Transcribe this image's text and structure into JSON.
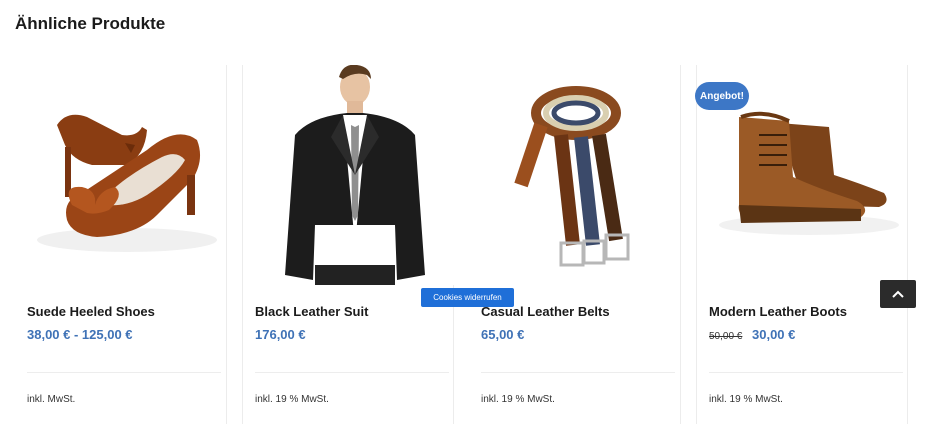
{
  "section": {
    "title": "Ähnliche Produkte"
  },
  "products": [
    {
      "name": "Suede Heeled Shoes",
      "price": "38,00 € - 125,00 €",
      "old_price": "",
      "tax": "inkl. MwSt.",
      "image_icon": "suede-heeled-shoes-image"
    },
    {
      "name": "Black Leather Suit",
      "price": "176,00 €",
      "old_price": "",
      "tax": "inkl. 19 % MwSt.",
      "image_icon": "black-leather-suit-image"
    },
    {
      "name": "Casual Leather Belts",
      "price": "65,00 €",
      "old_price": "",
      "tax": "inkl. 19 % MwSt.",
      "image_icon": "leather-belts-image"
    },
    {
      "name": "Modern Leather Boots",
      "price": "30,00 €",
      "old_price": "50,00 €",
      "tax": "inkl. 19 % MwSt.",
      "image_icon": "leather-boots-image"
    }
  ],
  "badge": {
    "label": "Angebot!"
  },
  "cookie": {
    "label": "Cookies widerrufen"
  },
  "scroll_top": {
    "icon": "chevron-up-icon"
  },
  "colors": {
    "price": "#3f72b6",
    "badge": "#3d77c6",
    "cookie_button": "#1f6fd8",
    "scroll_button": "#2b2b2b"
  }
}
